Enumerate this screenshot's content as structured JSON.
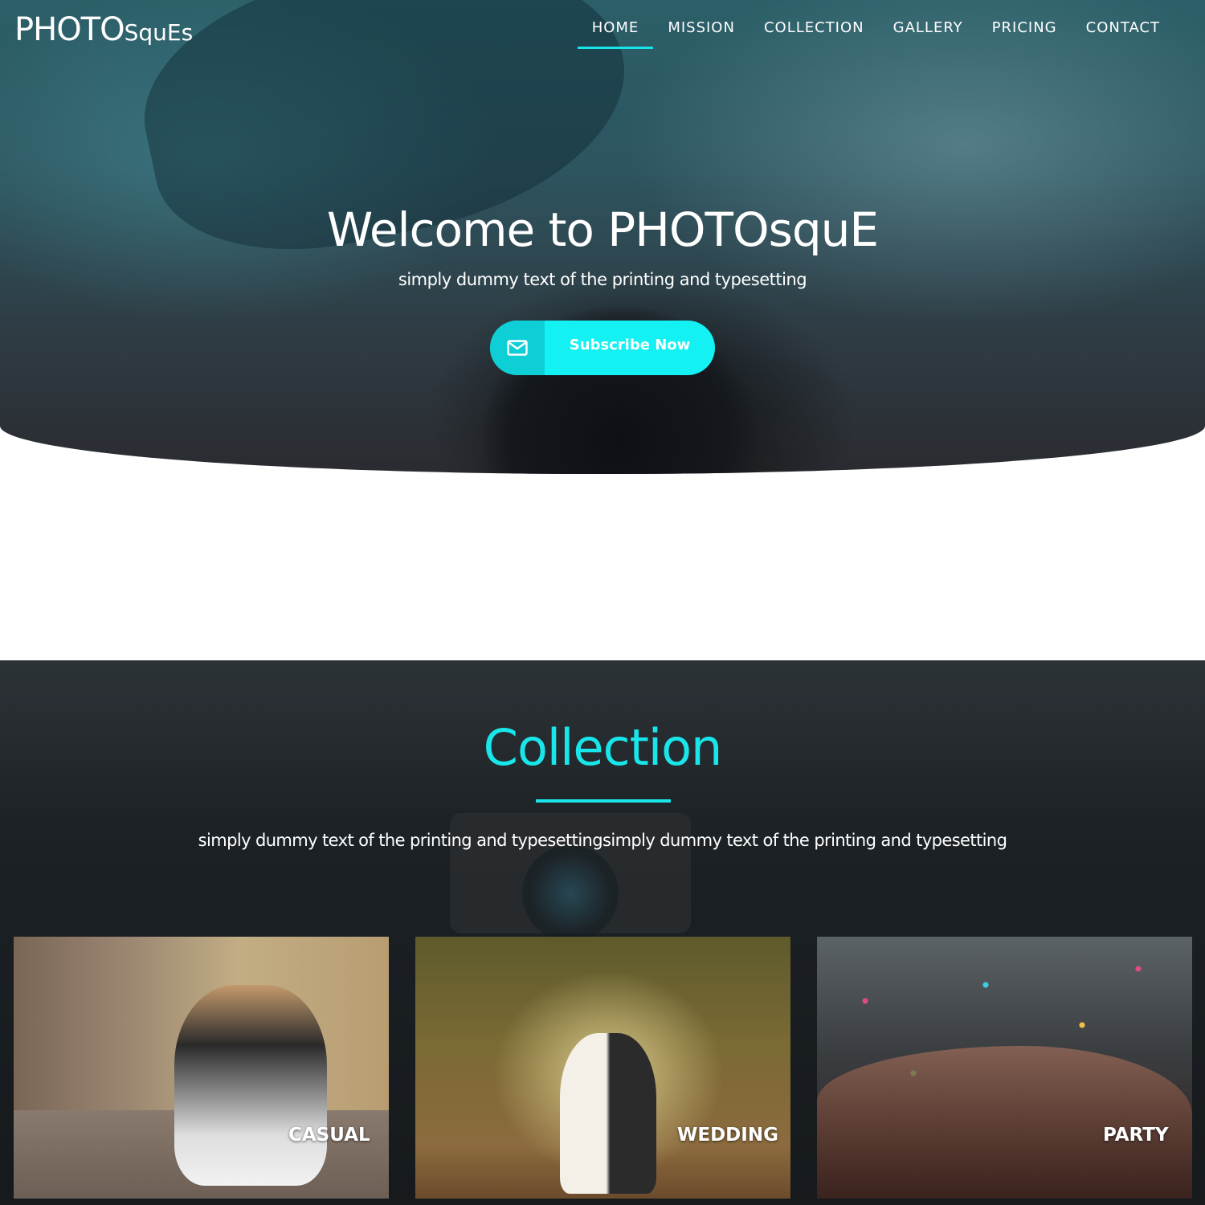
{
  "brand": {
    "main": "PHOTO",
    "small": "SquEs"
  },
  "nav": [
    {
      "label": "HOME",
      "active": true
    },
    {
      "label": "MISSION"
    },
    {
      "label": "COLLECTION"
    },
    {
      "label": "GALLERY"
    },
    {
      "label": "PRICING"
    },
    {
      "label": "CONTACT"
    }
  ],
  "hero": {
    "title": "Welcome to PHOTOsquE",
    "subtitle": "simply dummy text of the printing and typesetting",
    "subscribe_label": "Subscribe Now",
    "subscribe_icon": "envelope-icon"
  },
  "collection": {
    "title": "Collection",
    "subtitle": "simply dummy text of the printing and typesettingsimply dummy text of the printing and typesetting",
    "cards": [
      {
        "label": "CASUAL"
      },
      {
        "label": "WEDDING"
      },
      {
        "label": "PARTY"
      }
    ]
  },
  "colors": {
    "accent": "#13f1f3",
    "accent_dark": "#0fcfd6",
    "heading": "#19e6ea"
  }
}
